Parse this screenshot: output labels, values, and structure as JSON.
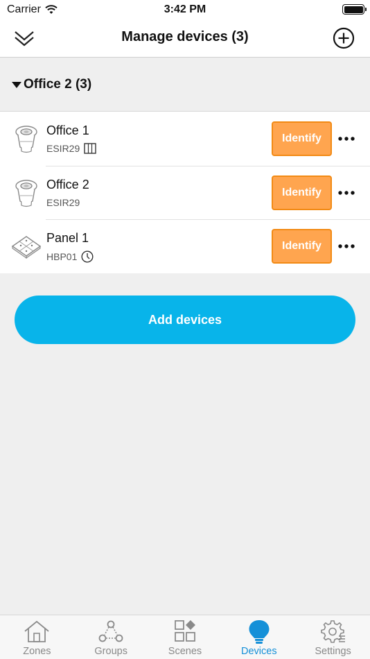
{
  "status_bar": {
    "carrier": "Carrier",
    "time": "3:42 PM"
  },
  "nav": {
    "title": "Manage devices (3)",
    "collapse_icon": "double-chevron-down-icon",
    "add_icon": "plus-circle-icon"
  },
  "group": {
    "title": "Office 2 (3)"
  },
  "devices": [
    {
      "name": "Office 1",
      "model": "ESIR29",
      "identify_label": "Identify",
      "icon": "sensor-icon",
      "badge": "window-icon"
    },
    {
      "name": "Office 2",
      "model": "ESIR29",
      "identify_label": "Identify",
      "icon": "sensor-icon",
      "badge": ""
    },
    {
      "name": "Panel 1",
      "model": "HBP01",
      "identify_label": "Identify",
      "icon": "panel-icon",
      "badge": "clock-icon"
    }
  ],
  "add_devices_label": "Add devices",
  "tabs": [
    {
      "label": "Zones",
      "icon": "house-icon",
      "active": false
    },
    {
      "label": "Groups",
      "icon": "groups-icon",
      "active": false
    },
    {
      "label": "Scenes",
      "icon": "scenes-icon",
      "active": false
    },
    {
      "label": "Devices",
      "icon": "bulb-icon",
      "active": true
    },
    {
      "label": "Settings",
      "icon": "gear-icon",
      "active": false
    }
  ],
  "colors": {
    "accent": "#08b4ea",
    "identify": "#ffa54f",
    "identify_border": "#f28a14",
    "active_tab": "#1590d8"
  }
}
